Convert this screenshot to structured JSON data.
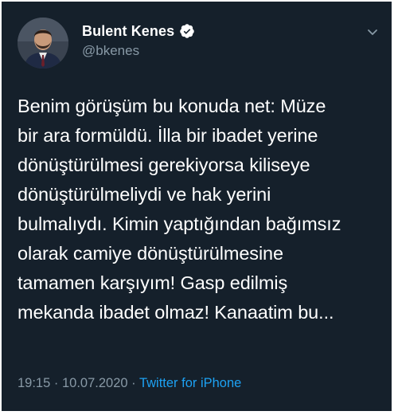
{
  "author": {
    "display_name": "Bulent Kenes",
    "handle": "@bkenes",
    "verified": true
  },
  "tweet": {
    "lines": [
      "Benim görüşüm bu konuda net: Müze",
      "bir ara formüldü. İlla bir ibadet yerine",
      "dönüştürülmesi gerekiyorsa kiliseye",
      "dönüştürülmeliydi ve hak yerini",
      "bulmalıydı. Kimin yaptığından bağımsız",
      "olarak camiye dönüştürülmesine",
      "tamamen karşıyım! Gasp edilmiş",
      "mekanda ibadet olmaz! Kanaatim bu..."
    ]
  },
  "meta": {
    "time": "19:15",
    "sep1": " · ",
    "date": "10.07.2020",
    "sep2": " · ",
    "source": "Twitter for iPhone"
  },
  "icons": {
    "verified": "verified-badge-icon",
    "menu": "chevron-down-icon"
  },
  "colors": {
    "background": "#15202b",
    "text": "#ffffff",
    "secondary": "#8899a6",
    "accent": "#1da1f2"
  }
}
